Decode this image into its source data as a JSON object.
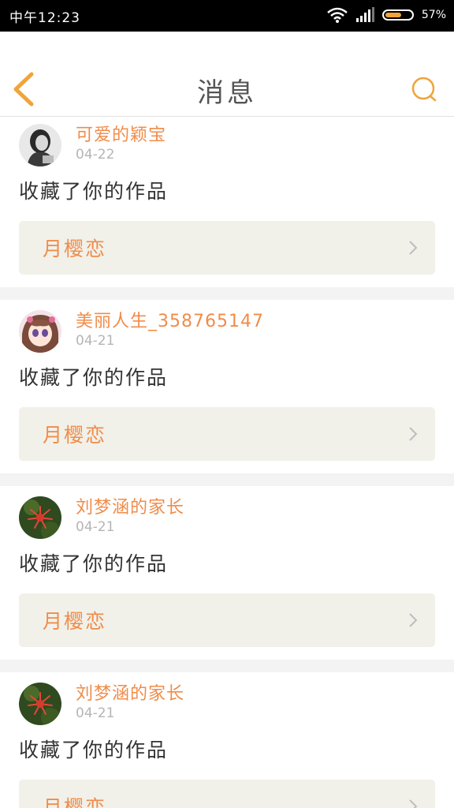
{
  "status_bar": {
    "time": "中午12:23",
    "battery": "57%",
    "battery_level": 0.57
  },
  "nav": {
    "title": "消息",
    "back_icon": "chevron-left-icon",
    "search_icon": "search-icon",
    "accent": "#f0a43a"
  },
  "notifications": [
    {
      "username": "可爱的颖宝",
      "date": "04-22",
      "action": "收藏了你的作品",
      "work_title": "月樱恋",
      "avatar": "portrait-girl"
    },
    {
      "username": "美丽人生_358765147",
      "date": "04-21",
      "action": "收藏了你的作品",
      "work_title": "月樱恋",
      "avatar": "anime-girl"
    },
    {
      "username": "刘梦涵的家长",
      "date": "04-21",
      "action": "收藏了你的作品",
      "work_title": "月樱恋",
      "avatar": "red-flower"
    },
    {
      "username": "刘梦涵的家长",
      "date": "04-21",
      "action": "收藏了你的作品",
      "work_title": "月樱恋",
      "avatar": "red-flower"
    }
  ],
  "colors": {
    "username": "#f08c4a",
    "work_bg": "#f1f1ea",
    "date": "#b5b5b5"
  }
}
